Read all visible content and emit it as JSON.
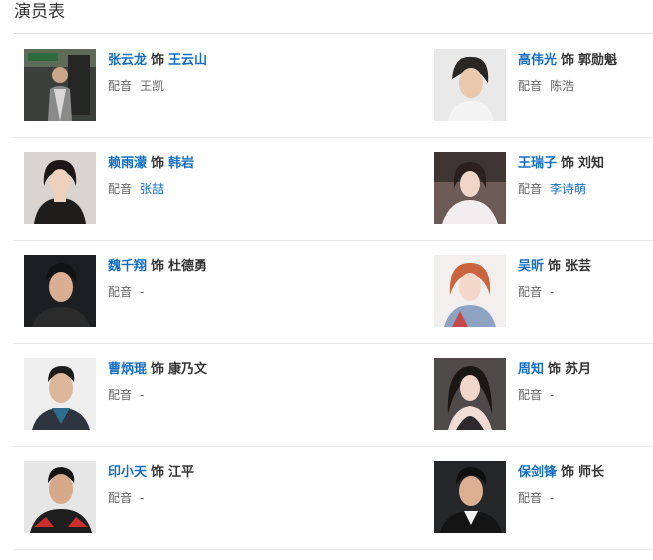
{
  "section": {
    "title": "演员表"
  },
  "ui": {
    "as_word": "饰",
    "dub_label": "配音"
  },
  "cast": [
    {
      "actor": "张云龙",
      "role": "王云山",
      "role_link": true,
      "voice": "王凯",
      "voice_link": false
    },
    {
      "actor": "高伟光",
      "role": "郭勋魁",
      "role_link": false,
      "voice": "陈浩",
      "voice_link": false
    },
    {
      "actor": "赖雨濛",
      "role": "韩岩",
      "role_link": true,
      "voice": "张喆",
      "voice_link": true
    },
    {
      "actor": "王瑞子",
      "role": "刘知",
      "role_link": false,
      "voice": "李诗萌",
      "voice_link": true
    },
    {
      "actor": "魏千翔",
      "role": "杜德勇",
      "role_link": false,
      "voice": "-",
      "voice_link": false
    },
    {
      "actor": "吴昕",
      "role": "张芸",
      "role_link": false,
      "voice": "-",
      "voice_link": false
    },
    {
      "actor": "曹炳琨",
      "role": "康乃文",
      "role_link": false,
      "voice": "-",
      "voice_link": false
    },
    {
      "actor": "周知",
      "role": "苏月",
      "role_link": false,
      "voice": "-",
      "voice_link": false
    },
    {
      "actor": "印小天",
      "role": "江平",
      "role_link": false,
      "voice": "-",
      "voice_link": false
    },
    {
      "actor": "保剑锋",
      "role": "师长",
      "role_link": false,
      "voice": "-",
      "voice_link": false
    }
  ]
}
